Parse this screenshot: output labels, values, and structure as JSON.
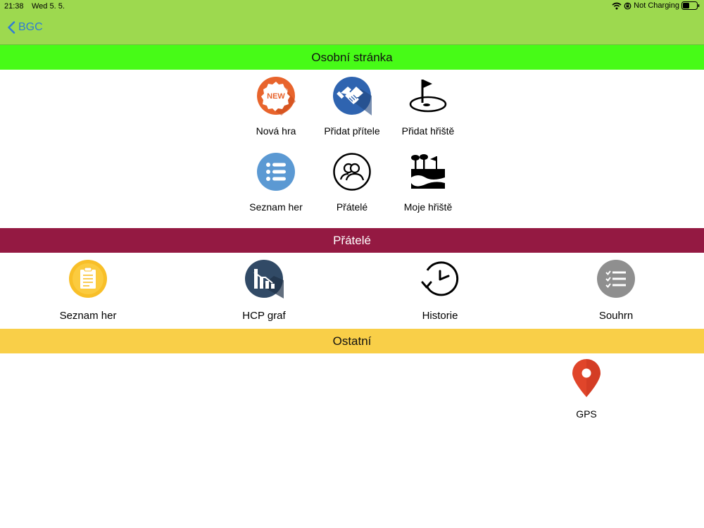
{
  "status_bar": {
    "time": "21:38",
    "date": "Wed 5. 5.",
    "battery_status": "Not Charging"
  },
  "nav": {
    "back_label": "BGC"
  },
  "sections": {
    "personal": {
      "title": "Osobní stránka",
      "color": "#47fb17",
      "items": [
        {
          "label": "Nová hra",
          "icon": "new-badge-icon"
        },
        {
          "label": "Přidat přítele",
          "icon": "handshake-icon"
        },
        {
          "label": "Přidat hřiště",
          "icon": "golf-flag-icon"
        },
        {
          "label": "Seznam her",
          "icon": "list-icon"
        },
        {
          "label": "Přátelé",
          "icon": "friends-icon"
        },
        {
          "label": "Moje hřiště",
          "icon": "golf-course-icon"
        }
      ]
    },
    "friends": {
      "title": "Přátelé",
      "color": "#941942",
      "items": [
        {
          "label": "Seznam her",
          "icon": "clipboard-icon"
        },
        {
          "label": "HCP graf",
          "icon": "chart-icon"
        },
        {
          "label": "Historie",
          "icon": "history-clock-icon"
        },
        {
          "label": "Souhrn",
          "icon": "checklist-icon"
        }
      ]
    },
    "other": {
      "title": "Ostatní",
      "color": "#f9cf48",
      "items": [
        {
          "label": "GPS",
          "icon": "map-pin-icon"
        }
      ]
    }
  },
  "colors": {
    "topbar": "#9dd94f",
    "link": "#2f7bd6"
  }
}
